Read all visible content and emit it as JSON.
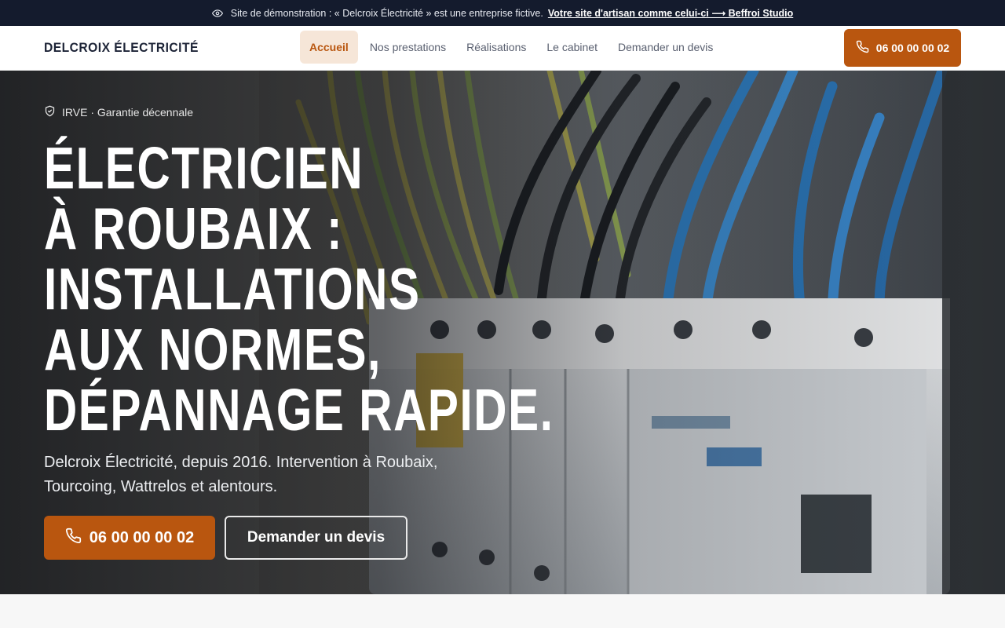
{
  "demo_banner": {
    "text": "Site de démonstration : « Delcroix Électricité » est une entreprise fictive.",
    "link": "Votre site d'artisan comme celui-ci ⟶ Beffroi Studio",
    "icon": "eye-icon"
  },
  "header": {
    "brand": "DELCROIX ÉLECTRICITÉ",
    "nav": [
      "Accueil",
      "Nos prestations",
      "Réalisations",
      "Le cabinet",
      "Demander un devis"
    ],
    "active_nav": "Accueil",
    "phone": "06 00 00 00 02",
    "phone_icon": "phone-icon"
  },
  "hero": {
    "badge": "IRVE · Garantie décennale",
    "badge_icon": "shield-check-icon",
    "title_lines": [
      "Électricien",
      "à Roubaix :",
      "installations",
      "aux normes,",
      "dépannage rapide."
    ],
    "subtitle": "Delcroix Électricité, depuis 2016. Intervention à Roubaix, Tourcoing, Wattrelos et alentours.",
    "call_label": "06 00 00 00 02",
    "quote_label": "Demander un devis"
  },
  "colors": {
    "accent": "#b9560f",
    "accent_soft": "#f6e6d8",
    "topbar": "#141b2d",
    "text_dark": "#1c2336"
  }
}
